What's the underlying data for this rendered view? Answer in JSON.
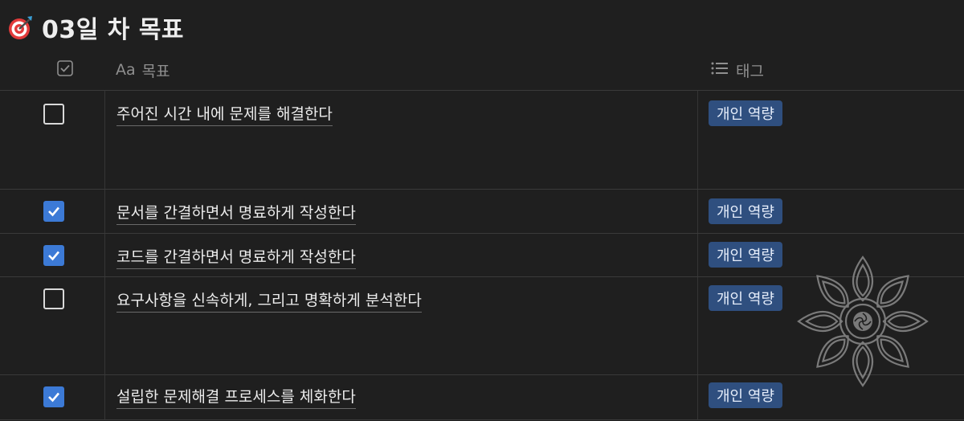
{
  "page": {
    "title": "03일 차 목표",
    "title_icon": "target-icon"
  },
  "table": {
    "headers": {
      "check_icon": "checkbox-icon",
      "goal": "목표",
      "goal_icon_text": "Aa",
      "tag": "태그",
      "tag_icon": "list-icon"
    },
    "rows": [
      {
        "checked": false,
        "goal": "주어진 시간 내에 문제를 해결한다",
        "tag": "개인 역량"
      },
      {
        "checked": true,
        "goal": "문서를 간결하면서 명료하게 작성한다",
        "tag": "개인 역량"
      },
      {
        "checked": true,
        "goal": "코드를 간결하면서 명료하게 작성한다",
        "tag": "개인 역량"
      },
      {
        "checked": false,
        "goal": "요구사항을 신속하게, 그리고 명확하게 분석한다",
        "tag": "개인 역량"
      },
      {
        "checked": true,
        "goal": "설립한 문제해결 프로세스를 체화한다",
        "tag": "개인 역량"
      }
    ]
  },
  "colors": {
    "background": "#1f1f1f",
    "checkbox_checked": "#3c7ad6",
    "tag_background": "#2f4f7f",
    "tag_text": "#e6eefb"
  }
}
